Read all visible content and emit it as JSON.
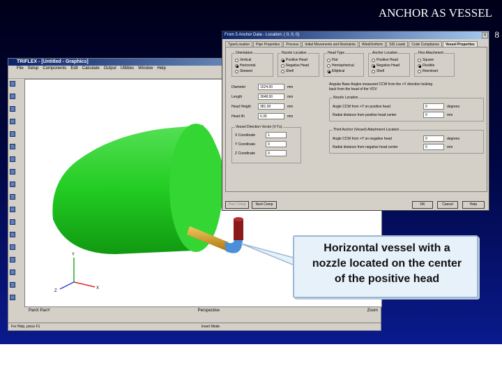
{
  "slide": {
    "title": "ANCHOR AS VESSEL",
    "page_number": "8"
  },
  "app": {
    "title": "TRIFLEX - [Untitled - Graphics]",
    "menu": [
      "File",
      "Setup",
      "Components",
      "Edit",
      "Calculate",
      "Output",
      "Utilities",
      "Window",
      "Help"
    ],
    "status_left": "For Help, press F1",
    "status_mode": "Insert Mode",
    "bottom_left": "PanX  PanY",
    "bottom_perspective": "Perspective",
    "bottom_zoom": "Zoom",
    "axis_labels": {
      "y": "Y",
      "z": "Z",
      "x": "X"
    }
  },
  "dialog": {
    "title": "From 5 Anchor Data - Location: ( 0, 0, 0)",
    "tabs": [
      "Type/Location",
      "Pipe Properties",
      "Process",
      "Initial Movements and Restraints",
      "Wind/Uniform",
      "SIS Loads",
      "Code Compliance",
      "Vessel Properties"
    ],
    "active_tab": "Vessel Properties",
    "orientation": {
      "title": "Orientation",
      "options": [
        "Vertical",
        "Horizontal",
        "Skewed"
      ],
      "selected": 1
    },
    "nozzle_location": {
      "title": "Nozzle Location",
      "options": [
        "Positive Head",
        "Negative Head",
        "Shell"
      ],
      "selected": 0
    },
    "head_type": {
      "title": "Head Type",
      "options": [
        "Flat",
        "Hemispherical",
        "Elliptical"
      ],
      "selected": 2
    },
    "anchor_location": {
      "title": "Anchor Location",
      "options": [
        "Positive Head",
        "Negative Head",
        "Shell"
      ],
      "selected": 1
    },
    "flex_attachment": {
      "title": "Flex Attachment",
      "options": [
        "Square",
        "Flexible",
        "Reentrant"
      ],
      "selected": 1
    },
    "dimensions": [
      {
        "label": "Diameter",
        "value": "1524.00",
        "unit": "mm"
      },
      {
        "label": "Length",
        "value": "3048.00",
        "unit": "mm"
      },
      {
        "label": "Head Height",
        "value": "381.00",
        "unit": "mm"
      },
      {
        "label": "Head t/h",
        "value": "6.35",
        "unit": "mm"
      }
    ],
    "angular_note": "Angular Base Angles measured CCW from the +Y direction looking back from the head of the VOV",
    "nozzle_group": {
      "title": "Nozzle Location",
      "rows": [
        {
          "label": "Angle CCW from +Y on positive head",
          "value": "0",
          "unit": "degrees"
        },
        {
          "label": "Radial distance from positive head center",
          "value": "0",
          "unit": "mm"
        }
      ]
    },
    "vector_group": {
      "title": "Vessel Direction Vector (V-Tu)",
      "rows": [
        {
          "label": "X Coordinate",
          "value": "1"
        },
        {
          "label": "Y Coordinate",
          "value": "0"
        },
        {
          "label": "Z Coordinate",
          "value": "0"
        }
      ]
    },
    "anchor_group": {
      "title": "Third Anchor (Vessel) Attachment Location",
      "rows": [
        {
          "label": "Angle CCW from +Y on negative head",
          "value": "0",
          "unit": "degrees"
        },
        {
          "label": "Radial distance from negative head center",
          "value": "0",
          "unit": "mm"
        }
      ]
    },
    "buttons": {
      "prev": "Prev Comp",
      "next": "Next Comp",
      "ok": "OK",
      "cancel": "Cancel",
      "help": "Help"
    }
  },
  "callout": {
    "line1": "Horizontal vessel with a",
    "line2": "nozzle located on the center",
    "line3": "of the positive head"
  },
  "colors": {
    "vessel": "#22cc22",
    "nozzle_pipe": "#d8a020",
    "elbow": "#4a8fd8",
    "nozzle_stub": "#8c1a1a"
  }
}
